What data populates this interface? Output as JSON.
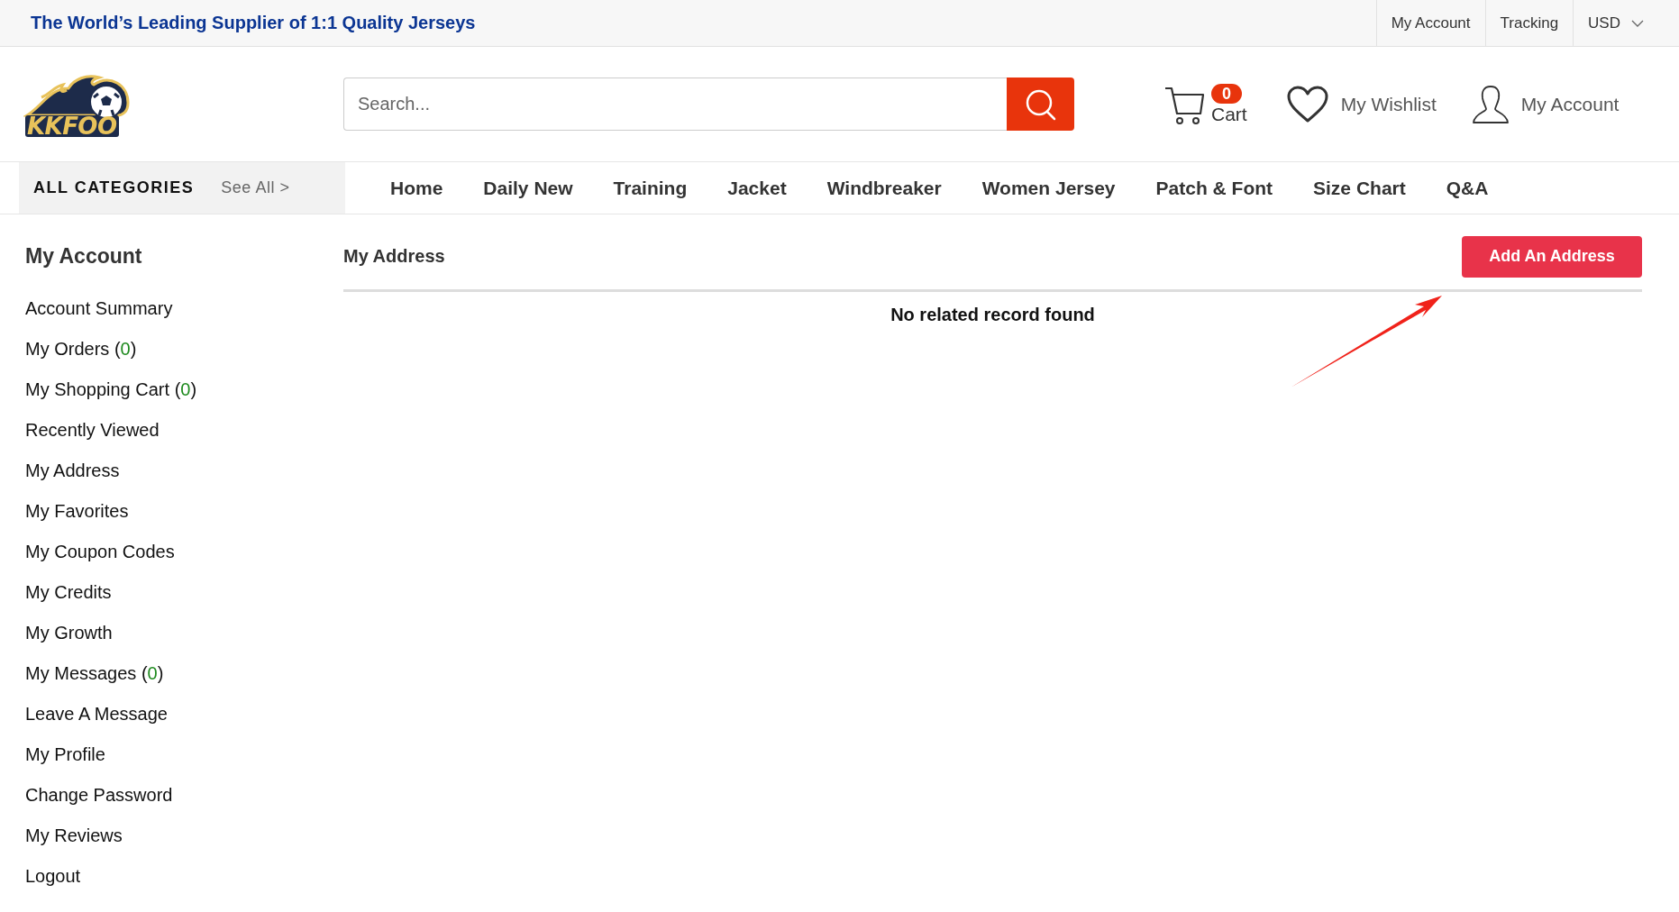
{
  "top_bar": {
    "tagline": "The World’s Leading Supplier of 1:1 Quality Jerseys",
    "links": [
      "My Account",
      "Tracking"
    ],
    "currency": "USD"
  },
  "header": {
    "logo_text": "KKFOO",
    "search": {
      "placeholder": "Search..."
    },
    "cart": {
      "count": "0",
      "label": "Cart"
    },
    "wishlist": "My Wishlist",
    "account": "My Account"
  },
  "nav": {
    "categories_label": "ALL CATEGORIES",
    "see_all": "See All >",
    "items": [
      "Home",
      "Daily New",
      "Training",
      "Jacket",
      "Windbreaker",
      "Women Jersey",
      "Patch & Font",
      "Size Chart",
      "Q&A"
    ]
  },
  "sidebar": {
    "title": "My Account",
    "items": [
      {
        "text": "Account Summary"
      },
      {
        "text": "My Orders (",
        "count": "0",
        "after": ")"
      },
      {
        "text": "My Shopping Cart (",
        "count": "0",
        "after": ")"
      },
      {
        "text": "Recently Viewed"
      },
      {
        "text": "My Address"
      },
      {
        "text": "My Favorites"
      },
      {
        "text": "My Coupon Codes"
      },
      {
        "text": "My Credits"
      },
      {
        "text": "My Growth"
      },
      {
        "text": "My Messages (",
        "count": "0",
        "after": ")"
      },
      {
        "text": "Leave A Message"
      },
      {
        "text": "My Profile"
      },
      {
        "text": "Change Password"
      },
      {
        "text": "My Reviews"
      },
      {
        "text": "Logout"
      }
    ]
  },
  "main": {
    "title": "My Address",
    "add_button": "Add An Address",
    "empty_message": "No related record found"
  }
}
